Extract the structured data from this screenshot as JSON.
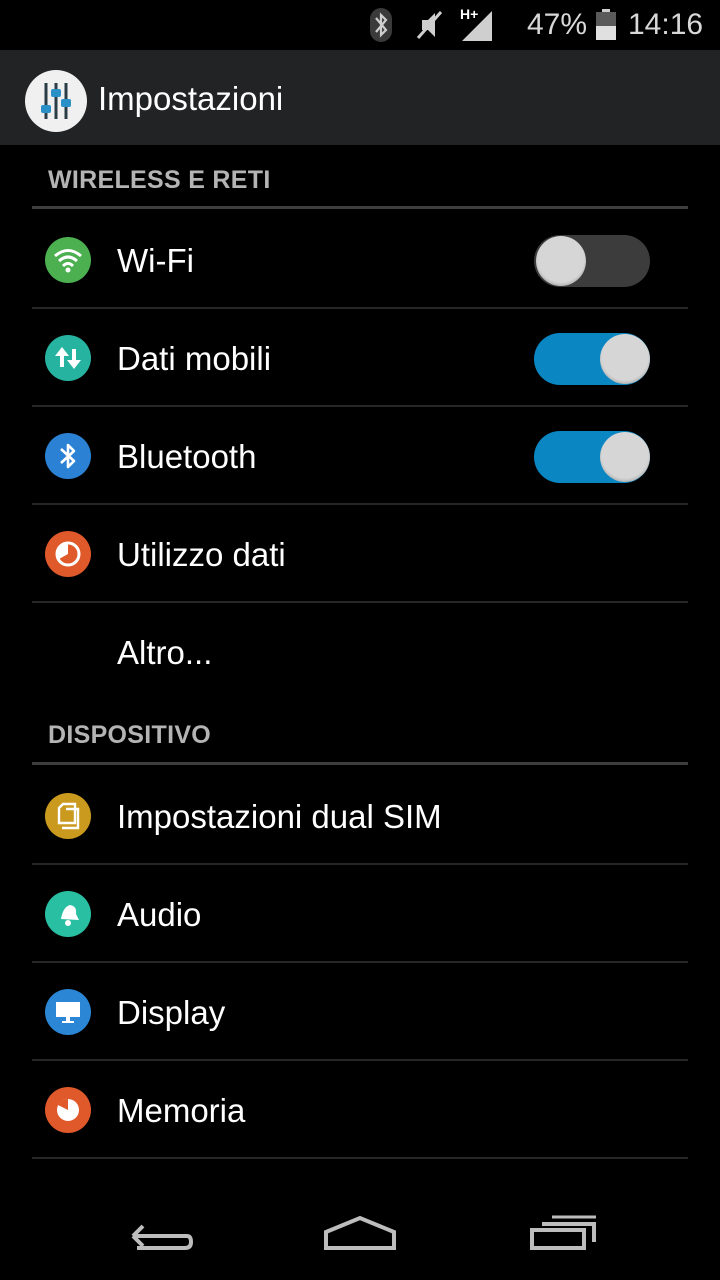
{
  "status_bar": {
    "icons": [
      "bluetooth-icon",
      "mute-icon",
      "signal-hplus-icon",
      "battery-icon"
    ],
    "network_label": "H+",
    "battery_percent": "47%",
    "battery_level": 0.47,
    "time": "14:16"
  },
  "action_bar": {
    "icon": "settings-sliders-icon",
    "title": "Impostazioni"
  },
  "sections": [
    {
      "header": "WIRELESS E RETI",
      "items": [
        {
          "label": "Wi-Fi",
          "icon": "wifi-icon",
          "icon_color": "#4caf50",
          "toggle": false
        },
        {
          "label": "Dati mobili",
          "icon": "data-transfer-icon",
          "icon_color": "#26b3a0",
          "toggle": true
        },
        {
          "label": "Bluetooth",
          "icon": "bluetooth-icon",
          "icon_color": "#2b82d4",
          "toggle": true
        },
        {
          "label": "Utilizzo dati",
          "icon": "data-usage-icon",
          "icon_color": "#e0592a"
        },
        {
          "label": "Altro..."
        }
      ]
    },
    {
      "header": "DISPOSITIVO",
      "items": [
        {
          "label": "Impostazioni dual SIM",
          "icon": "sim-card-icon",
          "icon_color": "#c99a1e"
        },
        {
          "label": "Audio",
          "icon": "bell-icon",
          "icon_color": "#29bfa3"
        },
        {
          "label": "Display",
          "icon": "monitor-icon",
          "icon_color": "#2b86d6"
        },
        {
          "label": "Memoria",
          "icon": "storage-pie-icon",
          "icon_color": "#e0592a"
        }
      ]
    }
  ],
  "nav_bar": {
    "buttons": [
      "back-icon",
      "home-icon",
      "recents-icon"
    ]
  },
  "colors": {
    "toggle_on": "#0a86c2",
    "toggle_off": "#3c3c3c",
    "action_bar_bg": "#222324"
  }
}
